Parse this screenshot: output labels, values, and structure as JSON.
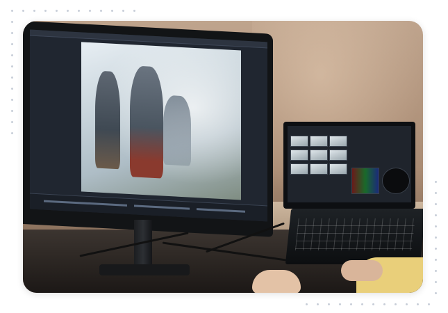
{
  "image": {
    "description_icon": "photo",
    "scene": "video-editing-desk-photo",
    "colors": {
      "background": "#ffffff",
      "dot_accent": "#c9cfd9",
      "wall": "#bfa48d",
      "monitor_bezel": "#121416"
    }
  }
}
